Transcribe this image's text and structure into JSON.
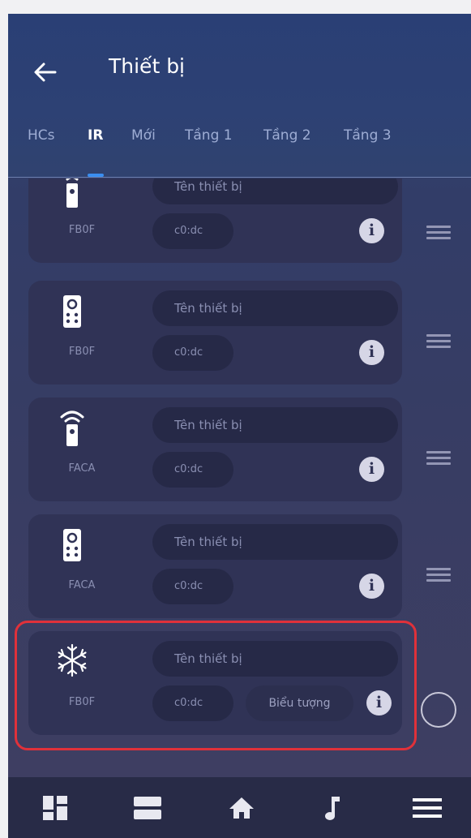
{
  "header": {
    "title": "Thiết bị"
  },
  "tabs": [
    {
      "label": "HCs"
    },
    {
      "label": "IR"
    },
    {
      "label": "Mới"
    },
    {
      "label": "Tầng 1"
    },
    {
      "label": "Tầng 2"
    },
    {
      "label": "Tầng 3"
    }
  ],
  "active_tab": "IR",
  "devices": [
    {
      "icon": "remote-wifi-icon",
      "code": "FB0F",
      "name_placeholder": "Tên thiết bị",
      "mac": "c0:dc"
    },
    {
      "icon": "remote-control-icon",
      "code": "FB0F",
      "name_placeholder": "Tên thiết bị",
      "mac": "c0:dc"
    },
    {
      "icon": "remote-wifi-icon",
      "code": "FACA",
      "name_placeholder": "Tên thiết bị",
      "mac": "c0:dc"
    },
    {
      "icon": "remote-control-icon",
      "code": "FACA",
      "name_placeholder": "Tên thiết bị",
      "mac": "c0:dc"
    },
    {
      "icon": "snowflake-icon",
      "code": "FB0F",
      "name_placeholder": "Tên thiết bị",
      "mac": "c0:dc",
      "icon_button": "Biểu tượng"
    }
  ],
  "bottom_nav": [
    {
      "icon": "dashboard-icon"
    },
    {
      "icon": "rooms-icon"
    },
    {
      "icon": "home-icon"
    },
    {
      "icon": "music-icon"
    },
    {
      "icon": "menu-icon"
    }
  ],
  "colors": {
    "header_bg": "#2d4174",
    "card_bg": "#303356",
    "tab_active_indicator": "#3a8ef0",
    "highlight_border": "#e0313a",
    "bottom_bar_bg": "#282b47"
  }
}
